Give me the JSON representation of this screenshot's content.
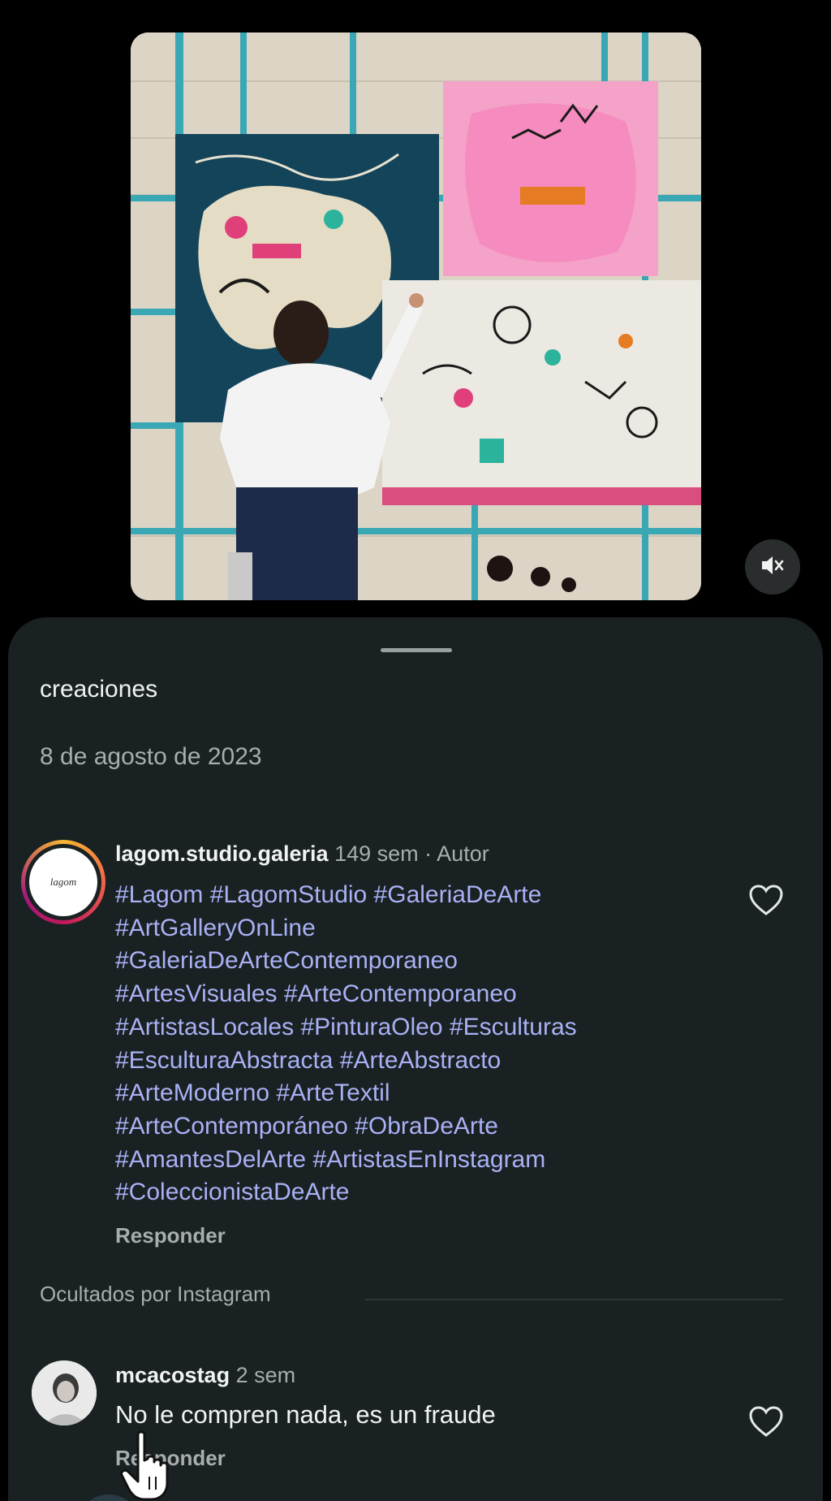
{
  "post": {
    "media_alt": "painting-video",
    "mute_icon": "speaker-muted-icon"
  },
  "sheet": {
    "caption": "creaciones",
    "date": "8 de agosto de 2023"
  },
  "comments": [
    {
      "username": "lagom.studio.galeria",
      "time": "149 sem",
      "separator": "·",
      "badge": "Autor",
      "avatar_text": "lagom",
      "hashtag_lines": [
        "#Lagom #LagomStudio #GaleriaDeArte",
        "#ArtGalleryOnLine",
        "#GaleriaDeArteContemporaneo",
        "#ArtesVisuales #ArteContemporaneo",
        "#ArtistasLocales #PinturaOleo #Esculturas",
        "#EsculturaAbstracta #ArteAbstracto",
        "#ArteModerno #ArteTextil",
        "#ArteContemporáneo #ObraDeArte",
        "#AmantesDelArte #ArtistasEnInstagram",
        "#ColeccionistaDeArte"
      ],
      "reply_label": "Responder"
    },
    {
      "username": "mcacostag",
      "time": "2 sem",
      "text": "No le compren nada, es un fraude",
      "reply_label": "Responder"
    }
  ],
  "hidden_section_label": "Ocultados por Instagram",
  "colors": {
    "sheet_bg": "#192122",
    "hashtag": "#a9b1f5",
    "muted_text": "#a8adaf"
  }
}
